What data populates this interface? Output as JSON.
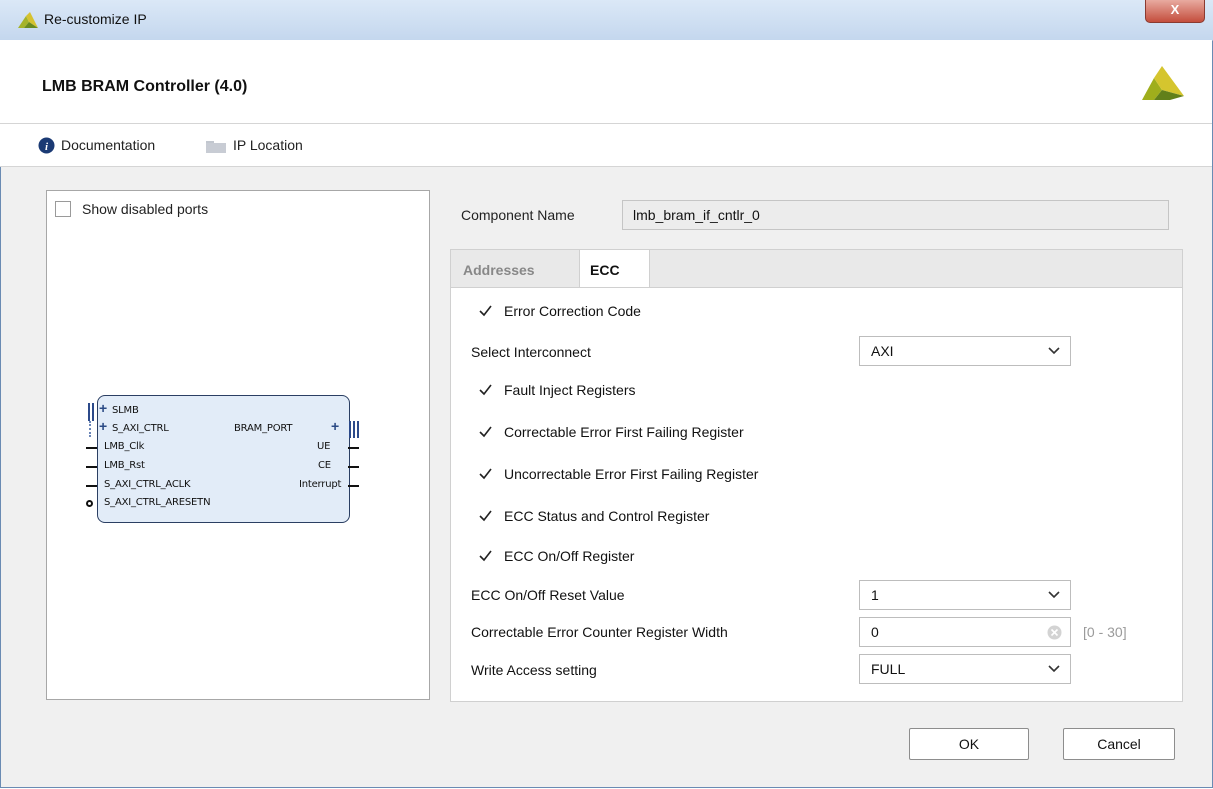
{
  "window": {
    "title": "Re-customize IP",
    "close_glyph": "X"
  },
  "header": {
    "title": "LMB BRAM Controller (4.0)",
    "logo_icon": "xilinx-logo-icon"
  },
  "toolbar": {
    "documentation_label": "Documentation",
    "ip_location_label": "IP Location"
  },
  "left_panel": {
    "show_disabled_ports_label": "Show disabled ports",
    "show_disabled_ports_checked": false,
    "block": {
      "left_ports": [
        "SLMB",
        "S_AXI_CTRL",
        "LMB_Clk",
        "LMB_Rst",
        "S_AXI_CTRL_ACLK",
        "S_AXI_CTRL_ARESETN"
      ],
      "right_ports": [
        "BRAM_PORT",
        "UE",
        "CE",
        "Interrupt"
      ]
    }
  },
  "component": {
    "label": "Component Name",
    "value": "lmb_bram_if_cntlr_0"
  },
  "tabs": [
    {
      "label": "Addresses",
      "active": false
    },
    {
      "label": "ECC",
      "active": true
    }
  ],
  "ecc": {
    "error_correction_code": {
      "label": "Error Correction Code",
      "checked": true
    },
    "select_interconnect": {
      "label": "Select Interconnect",
      "value": "AXI"
    },
    "fault_inject": {
      "label": "Fault Inject Registers",
      "checked": true
    },
    "ce_first_failing": {
      "label": "Correctable Error First Failing Register",
      "checked": true
    },
    "ue_first_failing": {
      "label": "Uncorrectable Error First Failing Register",
      "checked": true
    },
    "status_control": {
      "label": "ECC Status and Control Register",
      "checked": true
    },
    "onoff_register": {
      "label": "ECC On/Off Register",
      "checked": true
    },
    "onoff_reset": {
      "label": "ECC On/Off Reset Value",
      "value": "1"
    },
    "counter_width": {
      "label": "Correctable Error Counter Register Width",
      "value": "0",
      "range": "[0 - 30]"
    },
    "write_access": {
      "label": "Write Access setting",
      "value": "FULL"
    }
  },
  "buttons": {
    "ok": "OK",
    "cancel": "Cancel"
  },
  "colors": {
    "accent_logo": "#a7b51b",
    "block_fill": "#e2ecf8",
    "info_icon": "#1b3a74"
  }
}
